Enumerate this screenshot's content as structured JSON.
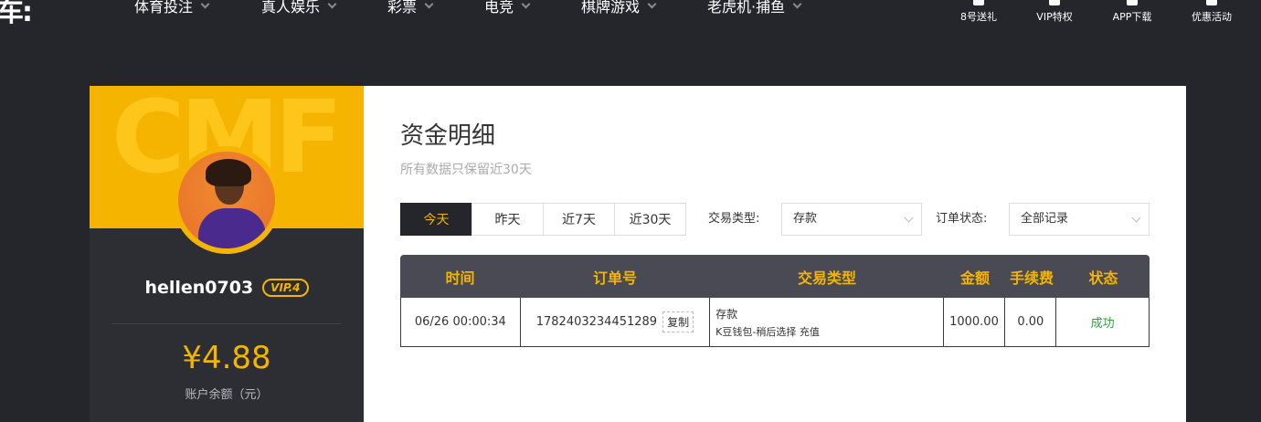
{
  "header": {
    "logo": "车:",
    "nav": [
      {
        "label": "体育投注"
      },
      {
        "label": "真人娱乐"
      },
      {
        "label": "彩票"
      },
      {
        "label": "电竞"
      },
      {
        "label": "棋牌游戏"
      },
      {
        "label": "老虎机·捕鱼"
      }
    ],
    "right_links": [
      {
        "label": "8号送礼",
        "icon": "gift-icon"
      },
      {
        "label": "VIP特权",
        "icon": "vip-icon"
      },
      {
        "label": "APP下载",
        "icon": "phone-icon"
      },
      {
        "label": "优惠活动",
        "icon": "promo-icon"
      }
    ]
  },
  "profile": {
    "watermark": "CMF",
    "username": "hellen0703",
    "vip": "VIP.4",
    "balance": "¥4.88",
    "balance_label": "账户余额（元）"
  },
  "main": {
    "title": "资金明细",
    "subtitle": "所有数据只保留近30天",
    "tabs": [
      {
        "label": "今天",
        "active": true
      },
      {
        "label": "昨天",
        "active": false
      },
      {
        "label": "近7天",
        "active": false
      },
      {
        "label": "近30天",
        "active": false
      }
    ],
    "filters": {
      "type_label": "交易类型:",
      "type_value": "存款",
      "status_label": "订单状态:",
      "status_value": "全部记录"
    },
    "table": {
      "headers": [
        "时间",
        "订单号",
        "交易类型",
        "金额",
        "手续费",
        "状态"
      ],
      "rows": [
        {
          "time": "06/26 00:00:34",
          "order_no": "1782403234451289",
          "copy_label": "复制",
          "type_main": "存款",
          "type_sub": "K豆钱包-稍后选择 充值",
          "amount": "1000.00",
          "fee": "0.00",
          "status": "成功"
        }
      ]
    }
  },
  "colors": {
    "accent": "#f5b400",
    "dark": "#25252c",
    "table_header": "#4a4a55",
    "success": "#2aa33b"
  }
}
